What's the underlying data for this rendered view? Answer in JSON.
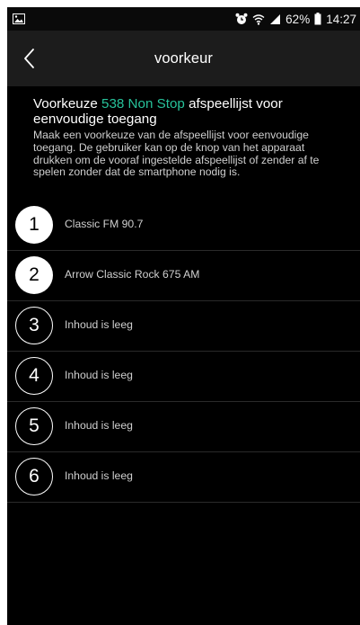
{
  "status_bar": {
    "battery": "62%",
    "time": "14:27"
  },
  "header": {
    "title": "voorkeur"
  },
  "intro": {
    "heading_prefix": "Voorkeuze ",
    "heading_accent": "538 Non Stop",
    "heading_suffix": " afspeellijst voor eenvoudige toegang",
    "description": "Maak een voorkeuze van de afspeellijst voor eenvoudige toegang. De gebruiker kan op de knop van het apparaat drukken om de vooraf ingestelde afspeellijst of zender af te spelen zonder dat de smartphone nodig is."
  },
  "presets": [
    {
      "number": "1",
      "label": "Classic FM 90.7",
      "filled": true
    },
    {
      "number": "2",
      "label": "Arrow Classic Rock 675 AM",
      "filled": true
    },
    {
      "number": "3",
      "label": "Inhoud is leeg",
      "filled": false
    },
    {
      "number": "4",
      "label": "Inhoud is leeg",
      "filled": false
    },
    {
      "number": "5",
      "label": "Inhoud is leeg",
      "filled": false
    },
    {
      "number": "6",
      "label": "Inhoud is leeg",
      "filled": false
    }
  ],
  "colors": {
    "accent": "#27c29a",
    "background": "#000000",
    "topbar": "#1c1c1c"
  },
  "icons": {
    "status_left": "image-icon",
    "alarm": "alarm-clock-icon",
    "wifi": "wifi-icon",
    "signal": "signal-icon",
    "battery": "battery-icon",
    "back": "chevron-left-icon"
  }
}
